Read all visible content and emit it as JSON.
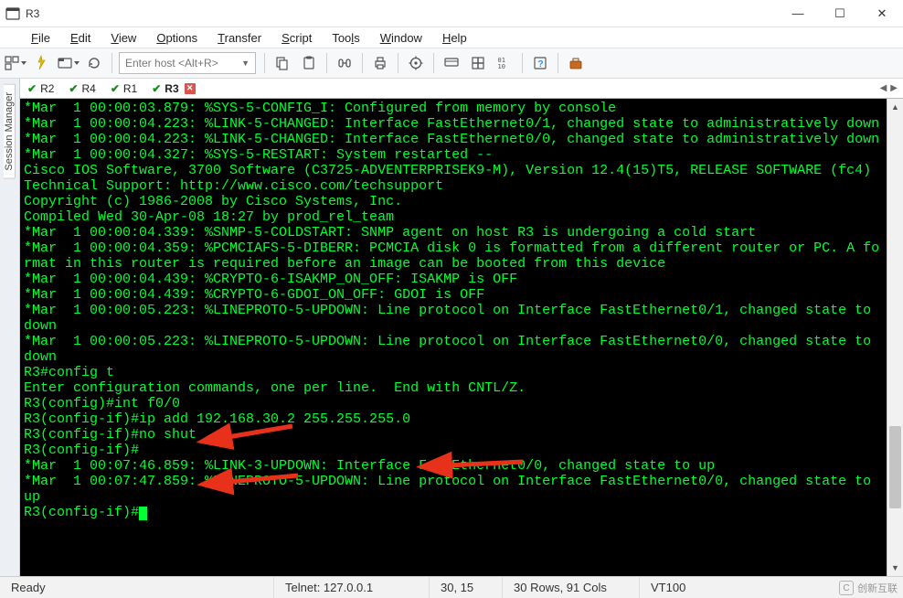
{
  "window": {
    "title": "R3",
    "minimize": "—",
    "maximize": "☐",
    "close": "✕"
  },
  "menubar": [
    "File",
    "Edit",
    "View",
    "Options",
    "Transfer",
    "Script",
    "Tools",
    "Window",
    "Help"
  ],
  "toolbar": {
    "host_placeholder": "Enter host <Alt+R>"
  },
  "side_panel": {
    "label": "Session Manager"
  },
  "session_tabs": [
    {
      "label": "R2",
      "active": false
    },
    {
      "label": "R4",
      "active": false
    },
    {
      "label": "R1",
      "active": false
    },
    {
      "label": "R3",
      "active": true
    }
  ],
  "terminal_lines": [
    "*Mar  1 00:00:03.879: %SYS-5-CONFIG_I: Configured from memory by console",
    "*Mar  1 00:00:04.223: %LINK-5-CHANGED: Interface FastEthernet0/1, changed state to administratively down",
    "*Mar  1 00:00:04.223: %LINK-5-CHANGED: Interface FastEthernet0/0, changed state to administratively down",
    "*Mar  1 00:00:04.327: %SYS-5-RESTART: System restarted --",
    "Cisco IOS Software, 3700 Software (C3725-ADVENTERPRISEK9-M), Version 12.4(15)T5, RELEASE SOFTWARE (fc4)",
    "Technical Support: http://www.cisco.com/techsupport",
    "Copyright (c) 1986-2008 by Cisco Systems, Inc.",
    "Compiled Wed 30-Apr-08 18:27 by prod_rel_team",
    "*Mar  1 00:00:04.339: %SNMP-5-COLDSTART: SNMP agent on host R3 is undergoing a cold start",
    "*Mar  1 00:00:04.359: %PCMCIAFS-5-DIBERR: PCMCIA disk 0 is formatted from a different router or PC. A format in this router is required before an image can be booted from this device",
    "*Mar  1 00:00:04.439: %CRYPTO-6-ISAKMP_ON_OFF: ISAKMP is OFF",
    "*Mar  1 00:00:04.439: %CRYPTO-6-GDOI_ON_OFF: GDOI is OFF",
    "*Mar  1 00:00:05.223: %LINEPROTO-5-UPDOWN: Line protocol on Interface FastEthernet0/1, changed state to down",
    "*Mar  1 00:00:05.223: %LINEPROTO-5-UPDOWN: Line protocol on Interface FastEthernet0/0, changed state to down",
    "R3#config t",
    "Enter configuration commands, one per line.  End with CNTL/Z.",
    "R3(config)#int f0/0",
    "R3(config-if)#ip add 192.168.30.2 255.255.255.0",
    "R3(config-if)#no shut",
    "R3(config-if)#",
    "*Mar  1 00:07:46.859: %LINK-3-UPDOWN: Interface FastEthernet0/0, changed state to up",
    "*Mar  1 00:07:47.859: %LINEPROTO-5-UPDOWN: Line protocol on Interface FastEthernet0/0, changed state to up",
    "R3(config-if)#"
  ],
  "status": {
    "ready": "Ready",
    "conn": "Telnet: 127.0.0.1",
    "cursor": "30,  15",
    "dims": "30 Rows, 91 Cols",
    "emul": "VT100"
  },
  "watermark": "创新互联"
}
